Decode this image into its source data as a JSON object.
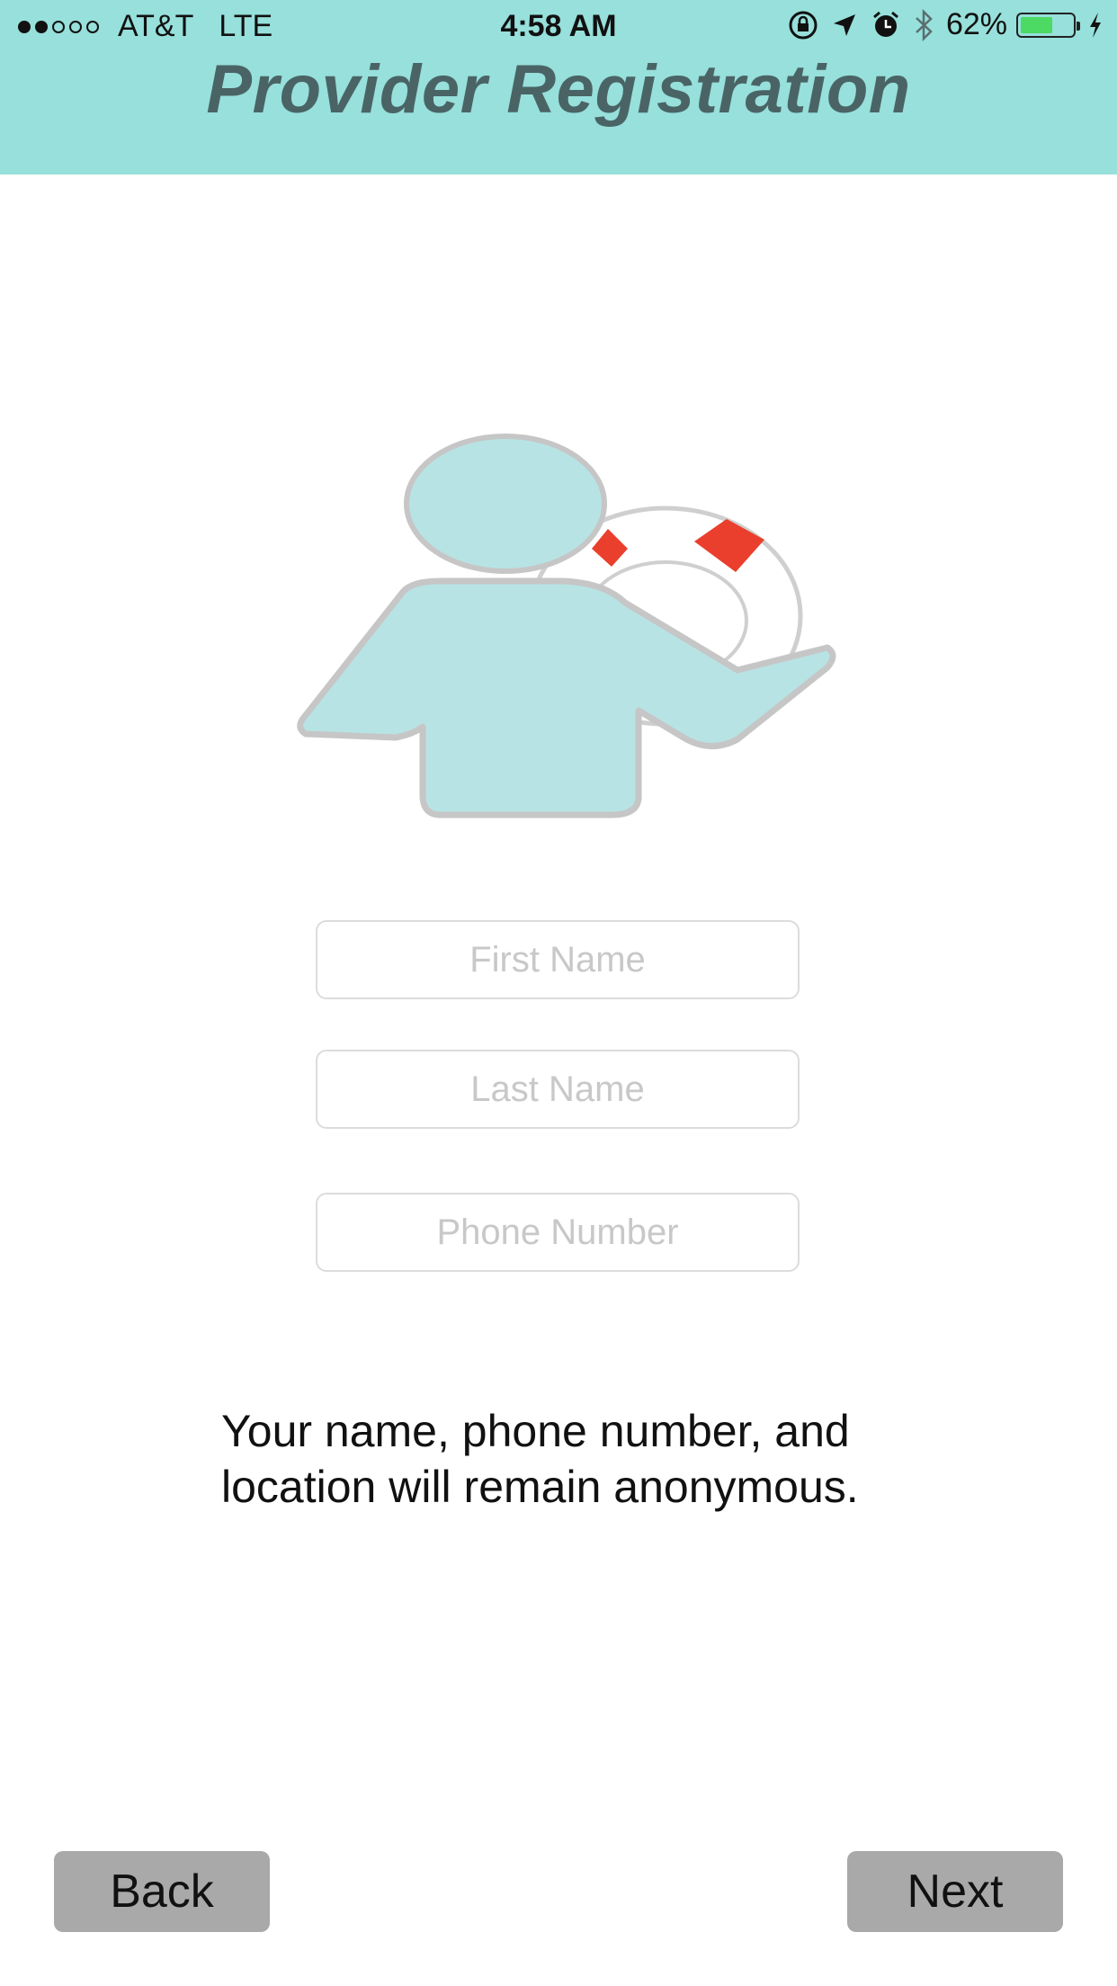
{
  "status_bar": {
    "signal_filled": 2,
    "signal_total": 5,
    "carrier": "AT&T",
    "network": "LTE",
    "time": "4:58 AM",
    "icons": [
      "rotation-lock-icon",
      "location-arrow-icon",
      "alarm-icon",
      "bluetooth-icon"
    ],
    "battery_percent": "62%",
    "battery_level": 0.62,
    "battery_color": "#4cd964"
  },
  "header": {
    "title": "Provider Registration",
    "background_color": "#97e0db",
    "title_color": "#4a6466"
  },
  "illustration": {
    "icon": "provider-lifebuoy-icon",
    "person_color": "#b8e3e4",
    "accent_color": "#ea3f2c"
  },
  "form": {
    "first_name_placeholder": "First Name",
    "last_name_placeholder": "Last Name",
    "phone_placeholder": "Phone Number",
    "first_name_value": "",
    "last_name_value": "",
    "phone_value": ""
  },
  "notice": "Your name, phone number, and location will remain anonymous.",
  "buttons": {
    "back": "Back",
    "next": "Next",
    "color": "#a8a9a8"
  }
}
